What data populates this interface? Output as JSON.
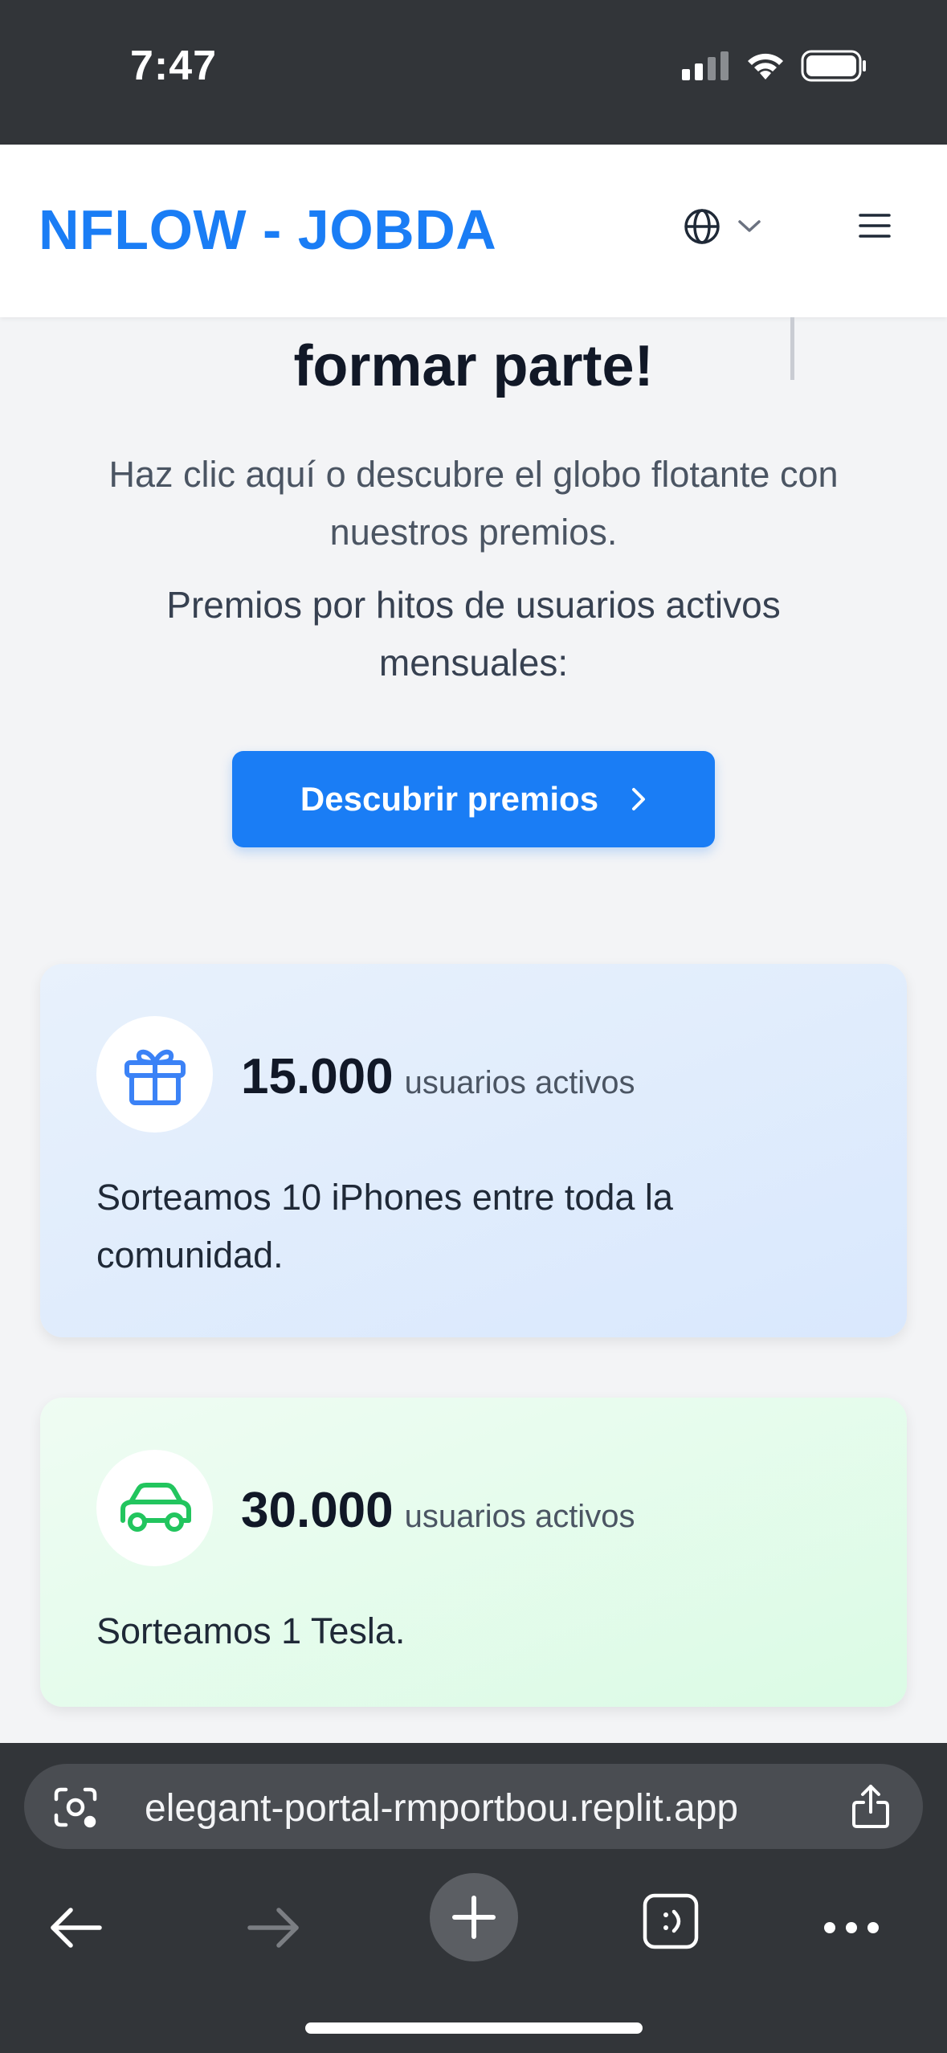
{
  "status_bar": {
    "time": "7:47"
  },
  "header": {
    "logo": "NFLOW - JOBDA"
  },
  "hero": {
    "title": "formar parte!",
    "description": "Haz clic aquí o descubre el globo flotante con nuestros premios.",
    "subtitle": "Premios por hitos de usuarios activos mensuales:",
    "cta_label": "Descubrir premios"
  },
  "cards": [
    {
      "value": "15.000",
      "label": "usuarios activos",
      "text": "Sorteamos 10 iPhones entre toda la comunidad.",
      "icon": "gift-icon",
      "accent": "#3b82f6"
    },
    {
      "value": "30.000",
      "label": "usuarios activos",
      "text": "Sorteamos 1 Tesla.",
      "icon": "car-icon",
      "accent": "#22c55e"
    }
  ],
  "browser": {
    "url": "elegant-portal-rmportbou.replit.app"
  },
  "colors": {
    "brand": "#1a7df5",
    "dark_bar": "#323539"
  }
}
